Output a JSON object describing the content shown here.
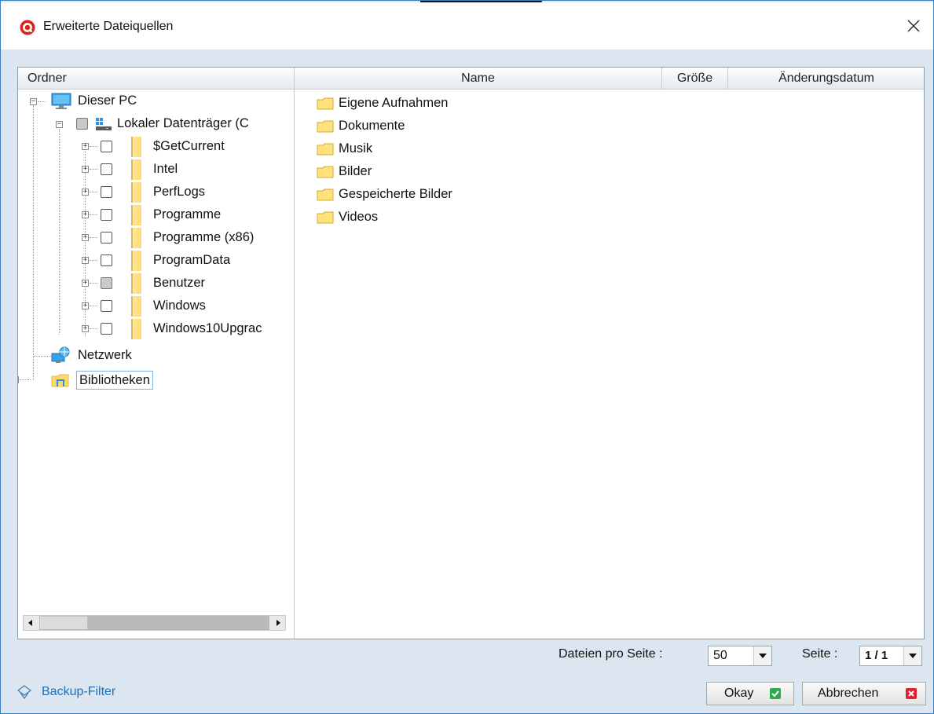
{
  "window": {
    "title": "Erweiterte Dateiquellen"
  },
  "columns": {
    "folder": "Ordner",
    "name": "Name",
    "size": "Größe",
    "modified": "Änderungsdatum"
  },
  "tree": {
    "pc": "Dieser PC",
    "drive": "Lokaler Datenträger (C",
    "folders": [
      {
        "label": "$GetCurrent",
        "partial": false
      },
      {
        "label": "Intel",
        "partial": false
      },
      {
        "label": "PerfLogs",
        "partial": false
      },
      {
        "label": "Programme",
        "partial": false
      },
      {
        "label": "Programme (x86)",
        "partial": false
      },
      {
        "label": "ProgramData",
        "partial": false
      },
      {
        "label": "Benutzer",
        "partial": true
      },
      {
        "label": "Windows",
        "partial": false
      },
      {
        "label": "Windows10Upgrac",
        "partial": false
      }
    ],
    "network": "Netzwerk",
    "libraries": "Bibliotheken"
  },
  "files": [
    "Eigene Aufnahmen",
    "Dokumente",
    "Musik",
    "Bilder",
    "Gespeicherte Bilder",
    "Videos"
  ],
  "paging": {
    "per_page_label": "Dateien pro Seite :",
    "per_page_value": "50",
    "page_label": "Seite :",
    "page_value": "1 / 1"
  },
  "footer": {
    "backup_filter": "Backup-Filter",
    "ok": "Okay",
    "cancel": "Abbrechen"
  },
  "colors": {
    "accent": "#3b7fc1",
    "ok_green": "#2fa84f",
    "cancel_red": "#e0222f",
    "folder_yellow": "#ffd86a"
  },
  "icons": {
    "app": "app-logo-icon",
    "close": "close-icon",
    "pc": "monitor-icon",
    "drive": "drive-icon",
    "network": "network-icon",
    "libraries": "libraries-icon",
    "filter": "filter-icon"
  }
}
